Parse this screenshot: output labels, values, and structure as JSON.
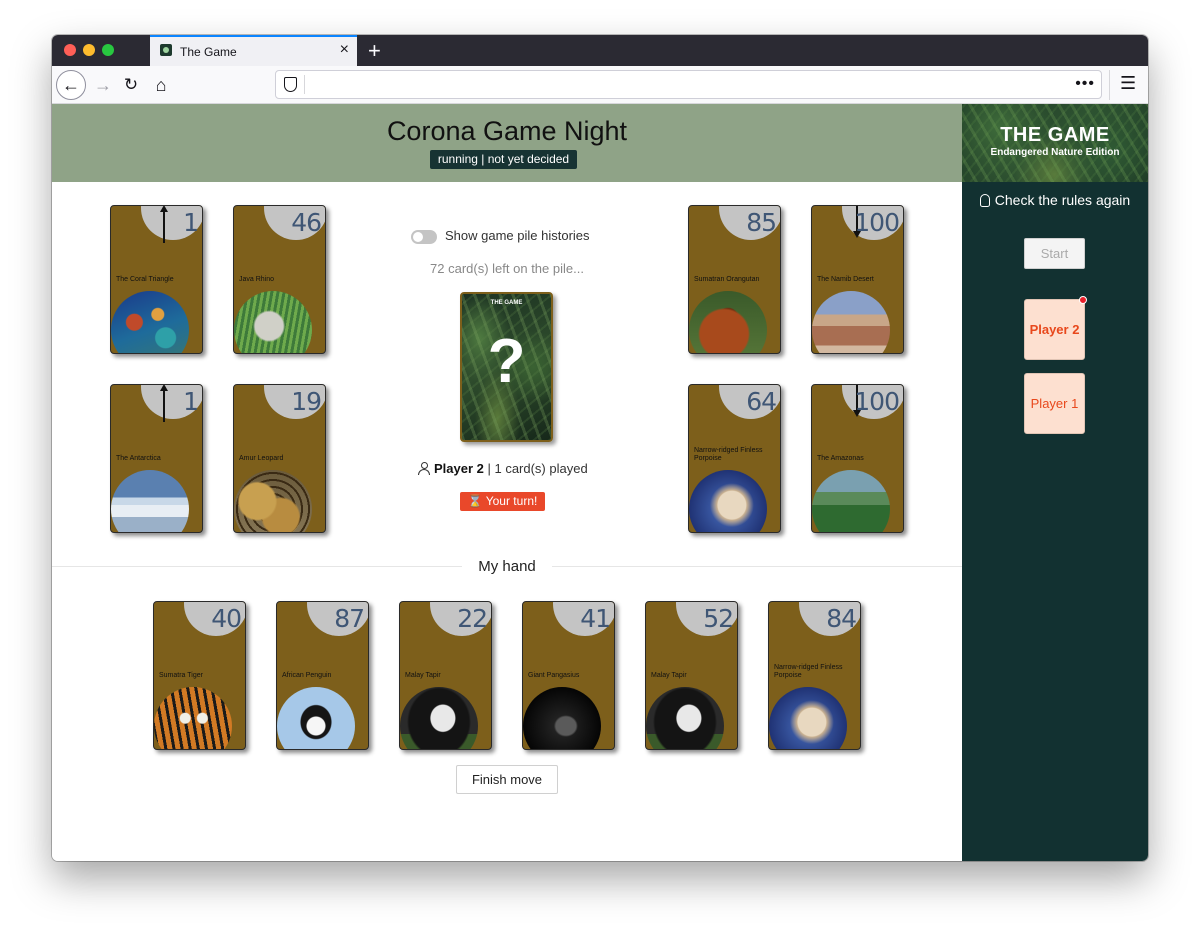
{
  "browser": {
    "tab_title": "The Game",
    "newtab_label": "+",
    "url": "",
    "url_dots": "•••",
    "menu_glyph": "☰"
  },
  "header": {
    "title": "Corona Game Night",
    "status": "running | not yet decided"
  },
  "sidebar": {
    "brand_title": "THE GAME",
    "brand_subtitle": "Endangered Nature Edition",
    "rules_link": "Check the rules again",
    "start_label": "Start",
    "players": [
      {
        "name": "Player 2",
        "active": true,
        "notification": true
      },
      {
        "name": "Player 1",
        "active": false,
        "notification": false
      }
    ]
  },
  "piles": [
    {
      "number": "1",
      "direction": "up",
      "name": "The Coral Triangle",
      "image": "coral-reef"
    },
    {
      "number": "46",
      "direction": "",
      "name": "Java Rhino",
      "image": "rhino"
    },
    {
      "number": "1",
      "direction": "up",
      "name": "The Antarctica",
      "image": "iceberg"
    },
    {
      "number": "19",
      "direction": "",
      "name": "Amur Leopard",
      "image": "leopard"
    },
    {
      "number": "85",
      "direction": "",
      "name": "Sumatran Orangutan",
      "image": "orangutan"
    },
    {
      "number": "100",
      "direction": "down",
      "name": "The Namib Desert",
      "image": "desert"
    },
    {
      "number": "64",
      "direction": "",
      "name": "Narrow-ridged Finless Porpoise",
      "image": "porpoise"
    },
    {
      "number": "100",
      "direction": "down",
      "name": "The Amazonas",
      "image": "rainforest"
    }
  ],
  "center": {
    "history_toggle_label": "Show game pile histories",
    "history_toggle_on": false,
    "cards_left": "72 card(s) left on the pile...",
    "back_title": "THE GAME",
    "back_glyph": "?",
    "current_player": "Player 2",
    "played_text": " | 1 card(s) played",
    "your_turn": "⌛ Your turn!"
  },
  "hand": {
    "title": "My hand",
    "cards": [
      {
        "number": "40",
        "name": "Sumatra Tiger",
        "image": "tiger"
      },
      {
        "number": "87",
        "name": "African Penguin",
        "image": "penguin"
      },
      {
        "number": "22",
        "name": "Malay Tapir",
        "image": "tapir"
      },
      {
        "number": "41",
        "name": "Giant Pangasius",
        "image": "pangasius"
      },
      {
        "number": "52",
        "name": "Malay Tapir",
        "image": "tapir"
      },
      {
        "number": "84",
        "name": "Narrow-ridged Finless Porpoise",
        "image": "porpoise"
      }
    ],
    "finish_label": "Finish move"
  }
}
